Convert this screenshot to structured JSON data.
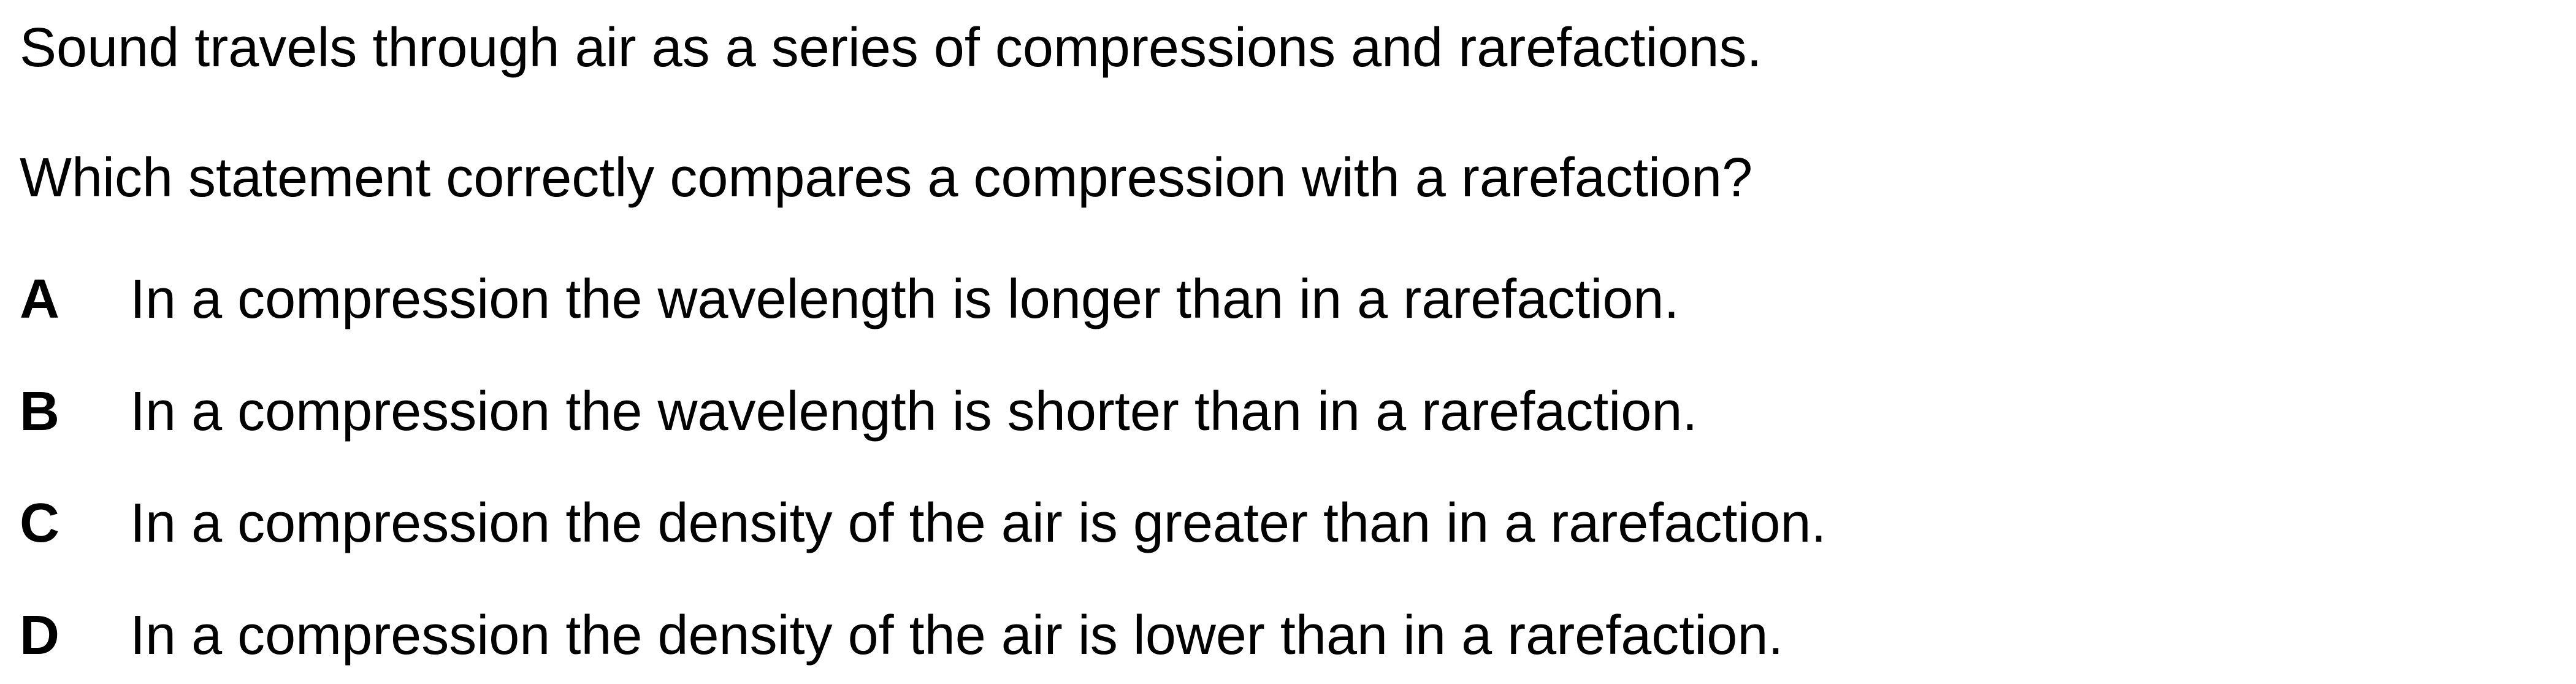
{
  "question": {
    "intro": "Sound travels through air as a series of compressions and rarefactions.",
    "prompt": "Which statement correctly compares a compression with a rarefaction?",
    "options": [
      {
        "letter": "A",
        "text": "In a compression the wavelength is longer than in a rarefaction."
      },
      {
        "letter": "B",
        "text": "In a compression the wavelength is shorter than in a rarefaction."
      },
      {
        "letter": "C",
        "text": "In a compression the density of the air is greater than in a rarefaction."
      },
      {
        "letter": "D",
        "text": "In a compression the density of the air is lower than in a rarefaction."
      }
    ]
  }
}
